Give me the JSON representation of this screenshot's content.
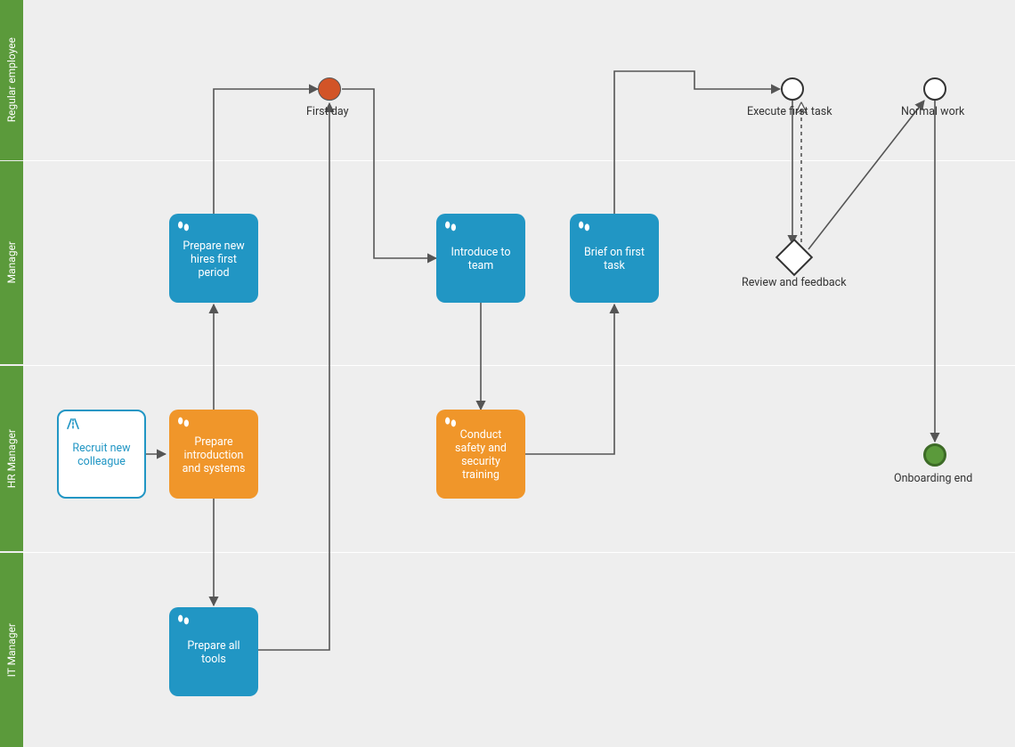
{
  "lanes": {
    "regular_employee": "Regular employee",
    "manager": "Manager",
    "hr_manager": "HR Manager",
    "it_manager": "IT Manager"
  },
  "tasks": {
    "recruit": "Recruit new colleague",
    "prepare_intro": "Prepare introduction and systems",
    "prepare_period": "Prepare new hires first period",
    "prepare_tools": "Prepare all tools",
    "introduce_team": "Introduce to team",
    "safety_training": "Conduct safety and security training",
    "brief_task": "Brief on first task"
  },
  "events": {
    "first_day": "First day",
    "execute_task": "Execute first task",
    "normal_work": "Normal work",
    "onboarding_end": "Onboarding end"
  },
  "gateway": {
    "review": "Review and feedback"
  }
}
